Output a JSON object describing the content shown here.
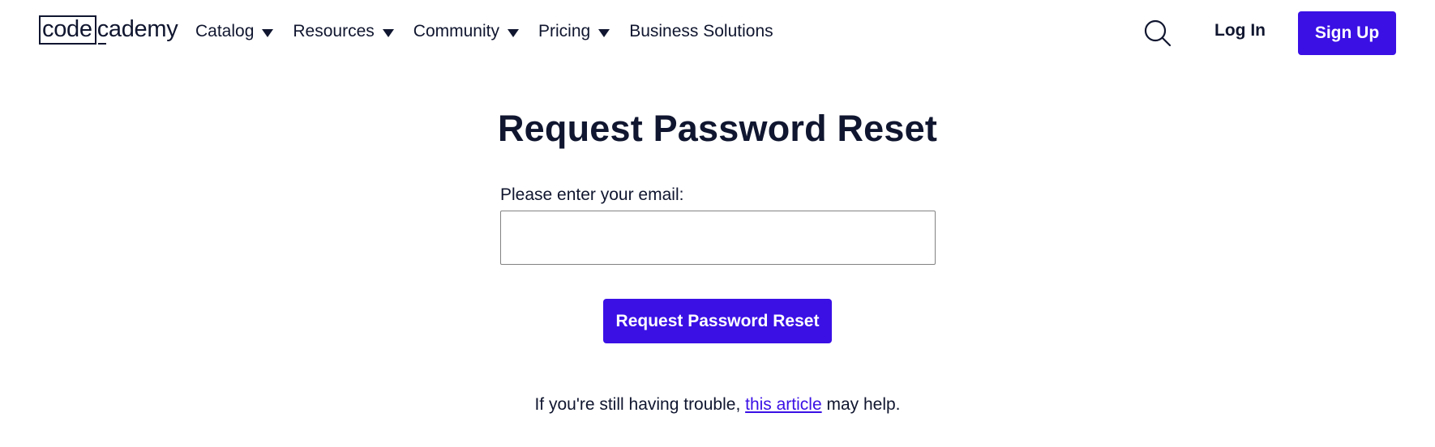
{
  "header": {
    "logo": {
      "box_text": "code",
      "rest_text": "cademy"
    },
    "nav": {
      "catalog": "Catalog",
      "resources": "Resources",
      "community": "Community",
      "pricing": "Pricing",
      "business": "Business Solutions"
    },
    "search_icon": "search-icon",
    "login_label": "Log In",
    "signup_label": "Sign Up"
  },
  "main": {
    "title": "Request Password Reset",
    "email_label": "Please enter your email:",
    "email_value": "",
    "submit_label": "Request Password Reset",
    "help": {
      "prefix": "If you're still having trouble, ",
      "link_text": "this article",
      "suffix": " may help."
    }
  },
  "colors": {
    "brand": "#3a10e5",
    "text": "#10162f",
    "input_border": "#828282"
  }
}
